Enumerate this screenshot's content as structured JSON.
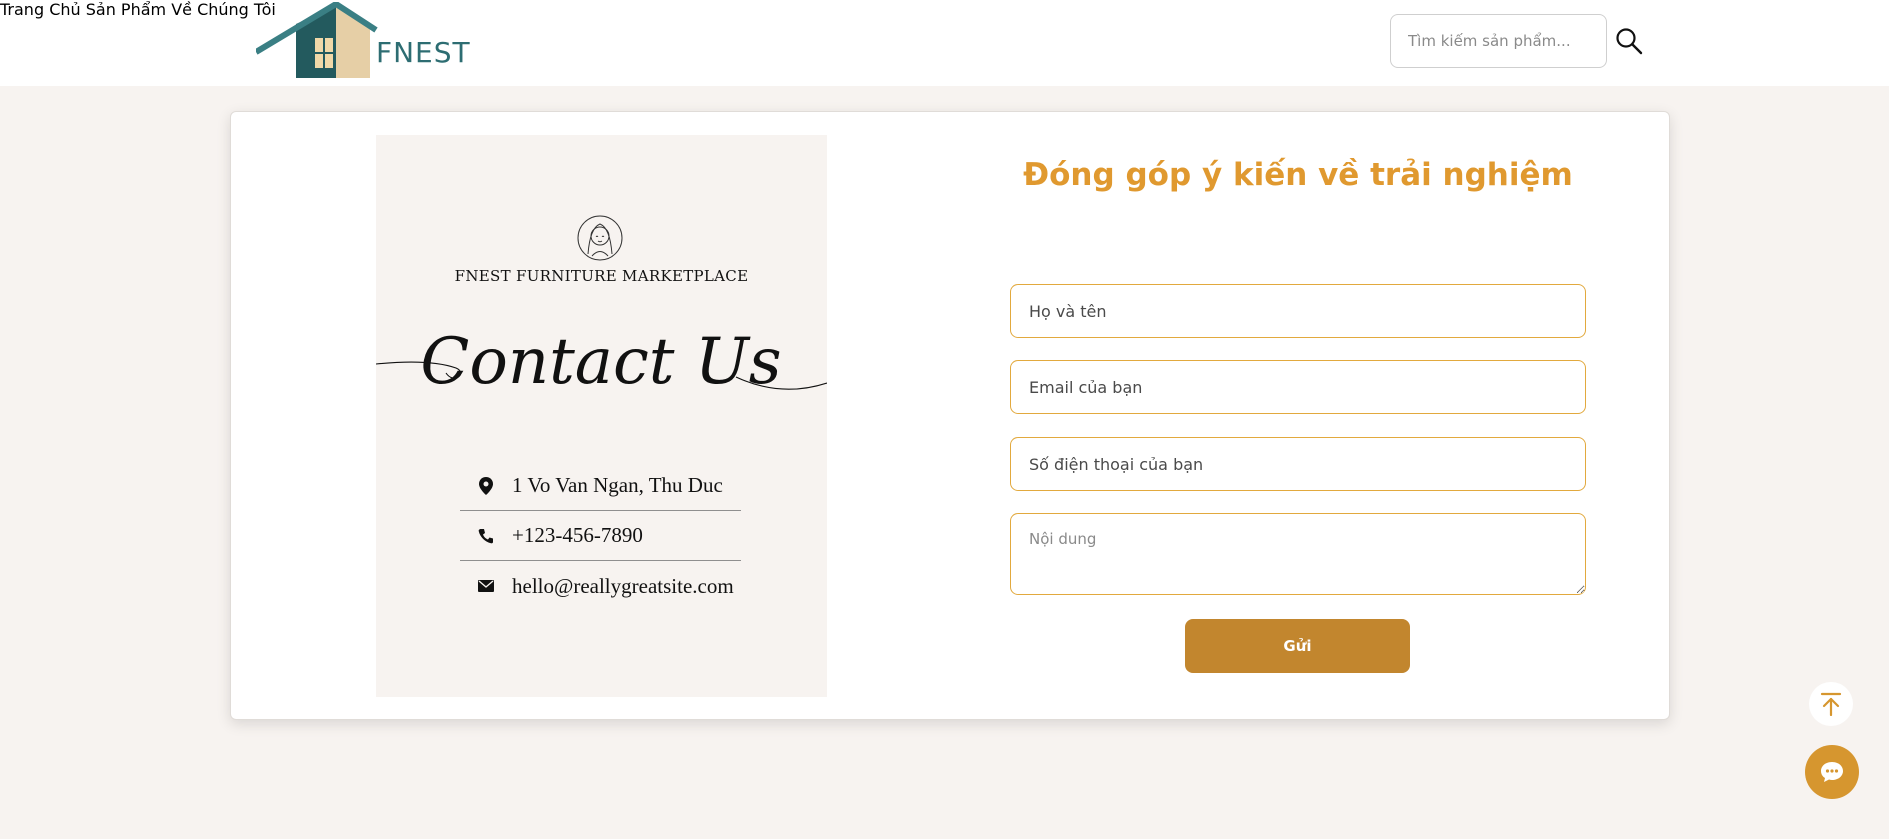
{
  "header": {
    "logo_text": "FNEST",
    "nav": [
      {
        "label": "Trang Chủ"
      },
      {
        "label": "Sản Phẩm"
      },
      {
        "label": "Về Chúng Tôi"
      }
    ],
    "search": {
      "placeholder": "Tìm kiếm sản phẩm...",
      "icon": "search-icon"
    }
  },
  "contact_card": {
    "brand": "FNEST FURNITURE MARKETPLACE",
    "script_title": "Contact Us",
    "rows": [
      {
        "icon": "location-pin-icon",
        "text": "1 Vo Van Ngan, Thu Duc"
      },
      {
        "icon": "phone-icon",
        "text": "+123-456-7890"
      },
      {
        "icon": "mail-icon",
        "text": "hello@reallygreatsite.com"
      }
    ]
  },
  "form": {
    "title": "Đóng góp ý kiến về trải nghiệm",
    "fields": {
      "name_placeholder": "Họ và tên",
      "email_placeholder": "Email của bạn",
      "phone_placeholder": "Số điện thoại của bạn",
      "content_placeholder": "Nội dung"
    },
    "submit_label": "Gửi"
  },
  "floating": {
    "to_top_icon": "arrow-up-to-line-icon",
    "chat_icon": "chat-bubble-icon"
  },
  "colors": {
    "accent": "#e0992f",
    "button": "#c2862e",
    "brand_teal": "#2d6d72",
    "background": "#f7f3f0"
  }
}
